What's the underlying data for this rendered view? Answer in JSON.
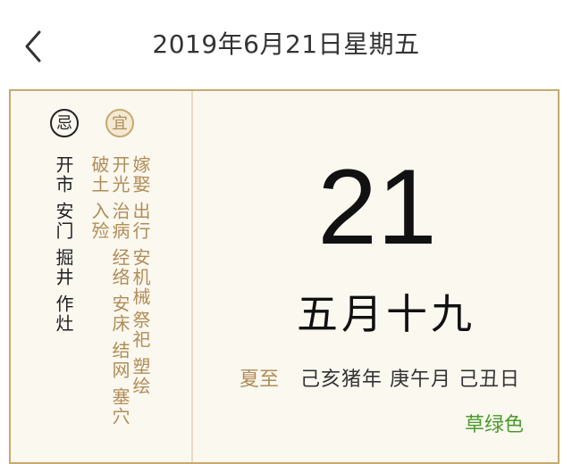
{
  "header": {
    "title": "2019年6月21日星期五",
    "back_icon": "chevron-left-icon"
  },
  "almanac": {
    "avoid_label": "忌",
    "suit_label": "宜",
    "avoid_items": [
      "开市",
      "安门",
      "掘井",
      "作灶"
    ],
    "suit_items": [
      "嫁娶",
      "开光",
      "破土",
      "出行",
      "治病",
      "入殓",
      "安机械",
      "经络",
      "祭祀",
      "安床",
      "塑绘",
      "结网",
      "塞穴"
    ],
    "colors": {
      "accent": "#c8a96d",
      "accent_text": "#b08d57",
      "tip_green": "#4a9a2a"
    }
  },
  "day": {
    "number": "21",
    "lunar": "五月十九",
    "solar_term": "夏至",
    "ganzhi": "己亥猪年 庚午月 己丑日",
    "color_tip": "草绿色"
  }
}
